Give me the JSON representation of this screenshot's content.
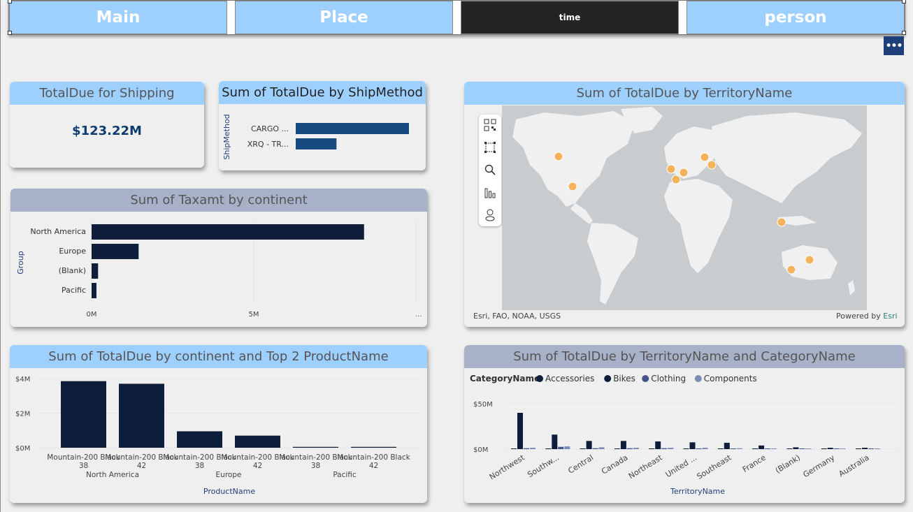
{
  "nav": {
    "buttons": [
      "Main",
      "Place",
      "time",
      "person"
    ],
    "active_index": 2,
    "more_label": "•••"
  },
  "kpi": {
    "title": "TotalDue for Shipping",
    "value": "$123.22M"
  },
  "shipmethod_chart": {
    "title": "Sum of TotalDue by ShipMethod",
    "ylabel": "ShipMethod"
  },
  "taxamt_chart": {
    "title": "Sum of Taxamt by continent",
    "ylabel": "Group",
    "more": "..."
  },
  "map": {
    "title": "Sum of TotalDue by TerritoryName",
    "attribution": "Esri, FAO, NOAA, USGS",
    "powered_by": "Powered by",
    "provider": "Esri",
    "tools": [
      "qr-select-icon",
      "rect-select-icon",
      "search-icon",
      "bar-chart-icon",
      "pegman-icon"
    ]
  },
  "product_chart": {
    "title": "Sum of TotalDue by continent and Top 2 ProductName",
    "xlabel": "ProductName"
  },
  "territory_chart": {
    "title": "Sum of TotalDue by TerritoryName and CategoryName",
    "legend_title": "CategoryName",
    "xlabel": "TerritoryName"
  },
  "chart_data": [
    {
      "type": "bar",
      "orientation": "horizontal",
      "title": "Sum of TotalDue by ShipMethod",
      "ylabel": "ShipMethod",
      "categories": [
        "CARGO ...",
        "XRQ - TR..."
      ],
      "values": [
        100,
        36
      ],
      "colors": [
        "#154b80"
      ]
    },
    {
      "type": "bar",
      "orientation": "horizontal",
      "title": "Sum of Taxamt by continent",
      "ylabel": "Group",
      "categories": [
        "North America",
        "Europe",
        "(Blank)",
        "Pacific"
      ],
      "values": [
        8.4,
        1.45,
        0.2,
        0.15
      ],
      "xticks": [
        "0M",
        "5M"
      ],
      "xlim": [
        0,
        10
      ],
      "colors": [
        "#0e1e3a"
      ]
    },
    {
      "type": "bar",
      "title": "Sum of TotalDue by continent and Top 2 ProductName",
      "xlabel": "ProductName",
      "groups": [
        "North America",
        "Europe",
        "Pacific"
      ],
      "categories": [
        "Mountain-200 Black, 38",
        "Mountain-200 Black, 42",
        "Mountain-200 Black, 38",
        "Mountain-200 Black, 42",
        "Mountain-200 Black, 38",
        "Mountain-200 Black, 42"
      ],
      "values": [
        3.85,
        3.7,
        0.95,
        0.7,
        0.05,
        0.05
      ],
      "yticks": [
        "$0M",
        "$2M",
        "$4M"
      ],
      "ylim": [
        0,
        4.2
      ],
      "colors": [
        "#0e1e3a"
      ]
    },
    {
      "type": "bar",
      "title": "Sum of TotalDue by TerritoryName and CategoryName",
      "xlabel": "TerritoryName",
      "categories": [
        "Northwest",
        "Southw...",
        "Central",
        "Canada",
        "Northeast",
        "United ...",
        "Southeast",
        "France",
        "(Blank)",
        "Germany",
        "Australia"
      ],
      "series": [
        {
          "name": "Accessories",
          "color": "#0e1e3a",
          "values": [
            0.5,
            0.4,
            0.4,
            0.3,
            0.3,
            0.3,
            0.3,
            0.2,
            0.2,
            0.2,
            0.2
          ]
        },
        {
          "name": "Bikes",
          "color": "#0e1e3a",
          "values": [
            40,
            16,
            9,
            9,
            8.5,
            7.5,
            7,
            4,
            2,
            1.5,
            1.5
          ]
        },
        {
          "name": "Clothing",
          "color": "#44548a",
          "values": [
            1.0,
            2.5,
            1.0,
            1.0,
            1.0,
            0.8,
            0.5,
            0.4,
            0.3,
            0.3,
            0.3
          ]
        },
        {
          "name": "Components",
          "color": "#7b8db5",
          "values": [
            1.5,
            3,
            2,
            1.5,
            1.5,
            1.5,
            1,
            0.8,
            0.5,
            0.5,
            0.5
          ]
        }
      ],
      "yticks": [
        "$0M",
        "$50M"
      ],
      "ylim": [
        0,
        50
      ]
    }
  ]
}
